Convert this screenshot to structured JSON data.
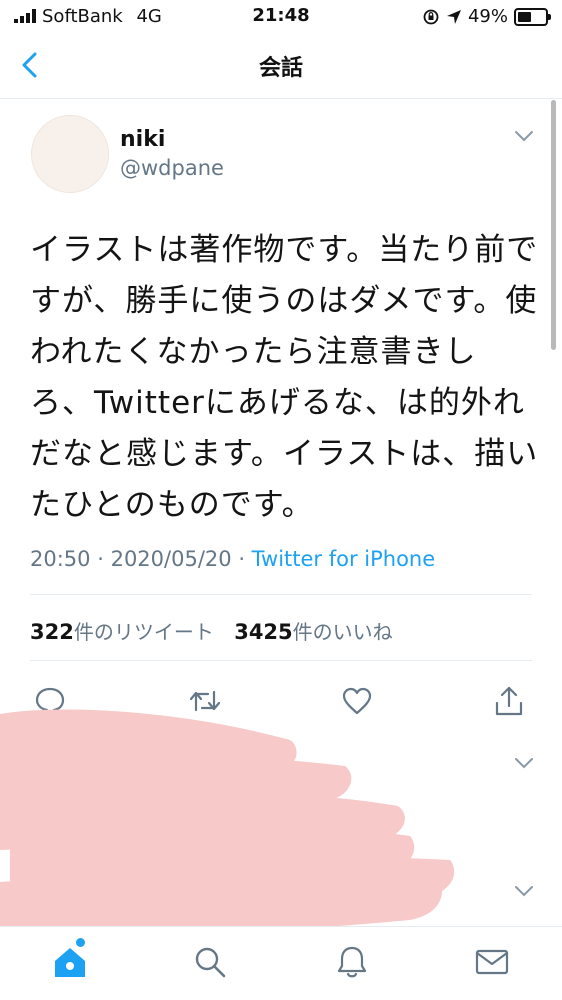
{
  "status_bar": {
    "carrier": "SoftBank",
    "network": "4G",
    "time": "21:48",
    "battery": "49%"
  },
  "nav": {
    "title": "会話"
  },
  "tweet": {
    "author_name": "niki",
    "author_handle": "@wdpane",
    "text": "イラストは著作物です。当たり前ですが、勝手に使うのはダメです。使われたくなかったら注意書きしろ、Twitterにあげるな、は的外れだなと感じます。イラストは、描いたひとのものです。",
    "time": "20:50",
    "date": "2020/05/20",
    "source": "Twitter for iPhone",
    "retweet_count": "322",
    "retweet_label": "件のリツイート",
    "like_count": "3425",
    "like_label": "件のいいね"
  },
  "colors": {
    "accent": "#1da1f2",
    "secondary_text": "#657786",
    "redaction": "#f7c9c9"
  },
  "icons": {
    "back": "chevron-left-icon",
    "reply": "reply-icon",
    "retweet": "retweet-icon",
    "like": "heart-icon",
    "share": "share-icon",
    "home": "home-icon",
    "search": "search-icon",
    "notifications": "bell-icon",
    "messages": "mail-icon"
  }
}
